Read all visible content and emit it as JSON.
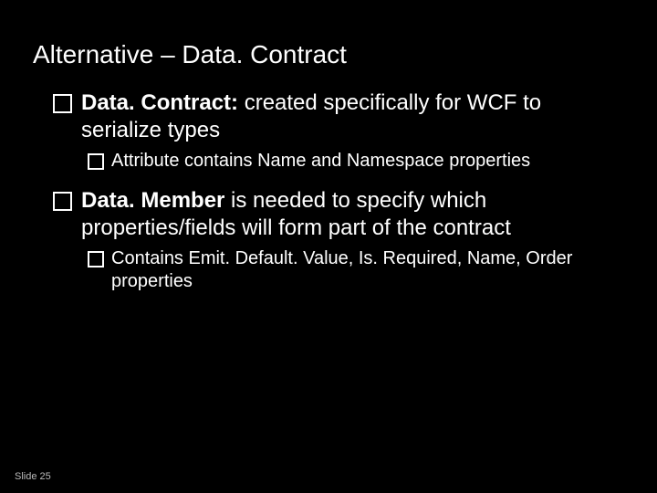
{
  "title": "Alternative – Data. Contract",
  "bullets": {
    "b1_bold": "Data. Contract:",
    "b1_rest": " created specifically for WCF to serialize types",
    "b1_sub": "Attribute contains Name and Namespace properties",
    "b2_bold": "Data. Member",
    "b2_rest": " is needed to specify which properties/fields will form part of the contract",
    "b2_sub": "Contains Emit. Default. Value, Is. Required, Name, Order properties"
  },
  "footer": "Slide 25"
}
